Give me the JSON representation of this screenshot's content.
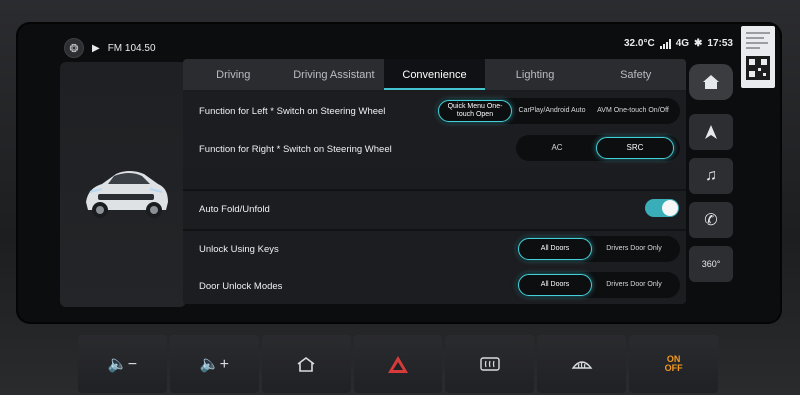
{
  "status": {
    "radio": "FM 104.50",
    "temperature": "32.0°C",
    "network": "4G",
    "time": "17:53"
  },
  "tabs": [
    {
      "label": "Driving"
    },
    {
      "label": "Driving Assistant"
    },
    {
      "label": "Convenience"
    },
    {
      "label": "Lighting"
    },
    {
      "label": "Safety"
    }
  ],
  "settings": {
    "left_switch": {
      "label": "Function for Left * Switch on Steering Wheel",
      "options": [
        "Quick Menu One-touch Open",
        "CarPlay/Android Auto",
        "AVM One-touch On/Off"
      ],
      "selected": "Quick Menu One-touch Open"
    },
    "right_switch": {
      "label": "Function for Right * Switch on Steering Wheel",
      "options": [
        "AC",
        "SRC"
      ],
      "selected": "SRC"
    },
    "auto_fold": {
      "label": "Auto Fold/Unfold",
      "enabled": true
    },
    "unlock_keys": {
      "label": "Unlock Using Keys",
      "options": [
        "All Doors",
        "Drivers Door Only"
      ],
      "selected": "All Doors"
    },
    "door_unlock": {
      "label": "Door Unlock Modes",
      "options": [
        "All Doors",
        "Drivers Door Only"
      ],
      "selected": "All Doors"
    }
  },
  "quicknav": {
    "view_360": "360°"
  },
  "hardware": {
    "eco_on": "ON",
    "eco_off": "OFF"
  },
  "colors": {
    "accent": "#45cfd8",
    "toggle_on": "#3aaeb8",
    "hazard": "#d63a3a",
    "eco": "#f39a1f"
  }
}
